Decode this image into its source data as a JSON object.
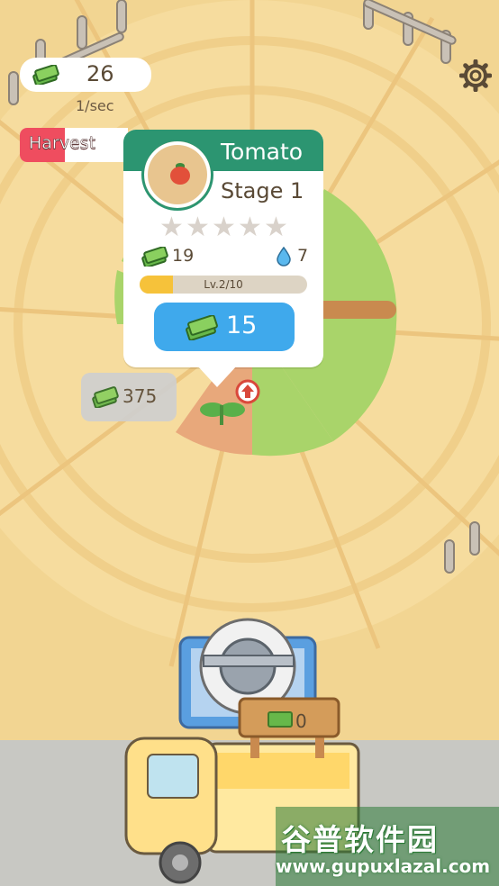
{
  "hud": {
    "money": "26",
    "rate": "1/sec",
    "harvest_label": "Harvest",
    "harvest_progress": 0.42,
    "settings_icon": "gear-icon"
  },
  "popup": {
    "crop_name": "Tomato",
    "stage": "Stage 1",
    "stars_total": 5,
    "stars_filled": 0,
    "yield_money": "19",
    "yield_water": "7",
    "level_text": "Lv.2/10",
    "level_progress": 0.2,
    "upgrade_cost": "15"
  },
  "field": {
    "sell_value": "375",
    "upgrade_indicator_icon": "up-arrow-icon"
  },
  "truck": {
    "sign_value": "0"
  },
  "watermark": {
    "main": "谷普软件园",
    "url": "www.gupuxlazal.com"
  },
  "colors": {
    "ground": "#f2d592",
    "accent_green": "#2c9571",
    "button_blue": "#3fa9ec",
    "harvest_red": "#ef4d5f",
    "level_yellow": "#f6c23a"
  }
}
